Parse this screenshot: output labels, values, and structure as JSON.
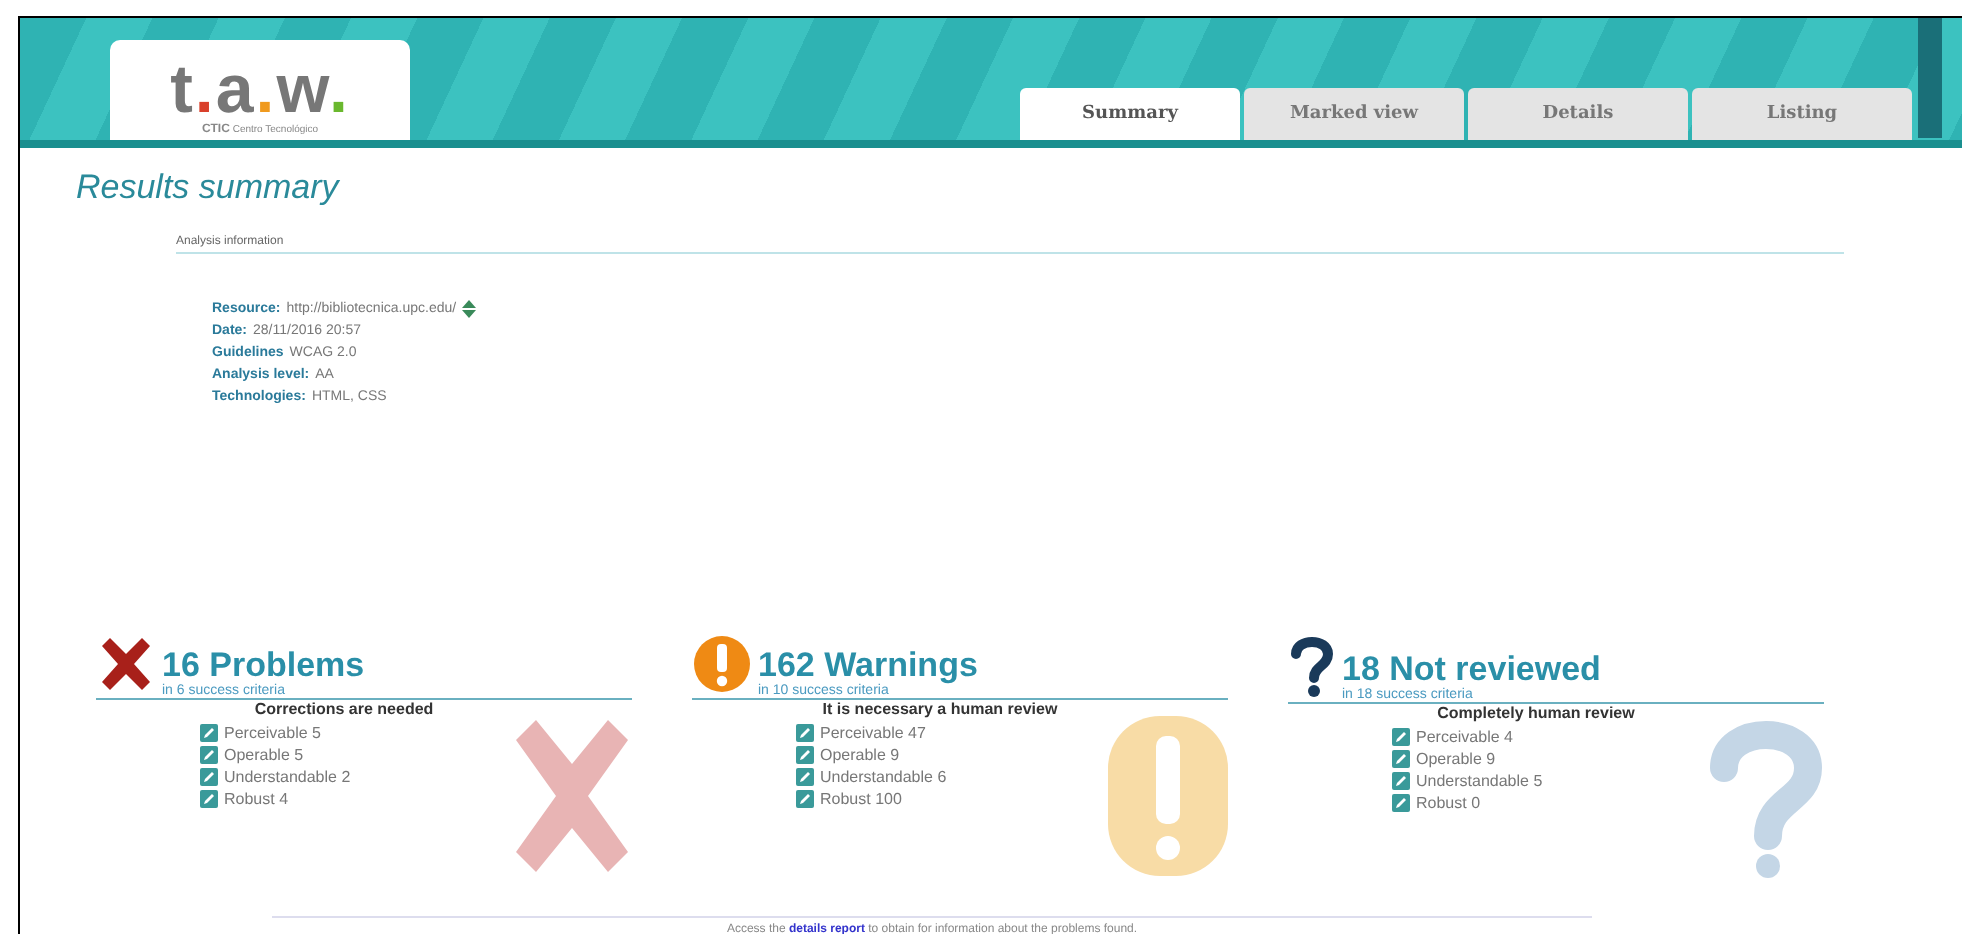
{
  "logo": {
    "text": "t.a.w.",
    "tagline_brand": "CTIC",
    "tagline": "Centro Tecnológico"
  },
  "tabs": [
    {
      "label": "Summary",
      "selected": true
    },
    {
      "label": "Marked view",
      "selected": false
    },
    {
      "label": "Details",
      "selected": false
    },
    {
      "label": "Listing",
      "selected": false
    }
  ],
  "title": "Results summary",
  "analysis": {
    "heading": "Analysis information",
    "items": [
      {
        "label": "Resource:",
        "value": "http://bibliotecnica.upc.edu/",
        "has_icon": true
      },
      {
        "label": "Date:",
        "value": "28/11/2016 20:57",
        "has_icon": false
      },
      {
        "label": "Guidelines",
        "value": "WCAG 2.0",
        "has_icon": false
      },
      {
        "label": "Analysis level:",
        "value": "AA",
        "has_icon": false
      },
      {
        "label": "Technologies:",
        "value": "HTML, CSS",
        "has_icon": false
      }
    ]
  },
  "results": [
    {
      "kind": "problems",
      "title": "16 Problems",
      "subtitle": "in 6 success criteria",
      "note": "Corrections are needed",
      "items": [
        "Perceivable 5",
        "Operable 5",
        "Understandable 2",
        "Robust 4"
      ]
    },
    {
      "kind": "warnings",
      "title": "162 Warnings",
      "subtitle": "in 10 success criteria",
      "note": "It is necessary a human review",
      "items": [
        "Perceivable 47",
        "Operable 9",
        "Understandable 6",
        "Robust 100"
      ]
    },
    {
      "kind": "not_reviewed",
      "title": "18 Not reviewed",
      "subtitle": "in 18 success criteria",
      "note": "Completely human review",
      "items": [
        "Perceivable 4",
        "Operable 9",
        "Understandable 5",
        "Robust 0"
      ]
    }
  ],
  "footer": {
    "before": "Access the",
    "link": "details report",
    "after": "to obtain for information about the problems found."
  }
}
